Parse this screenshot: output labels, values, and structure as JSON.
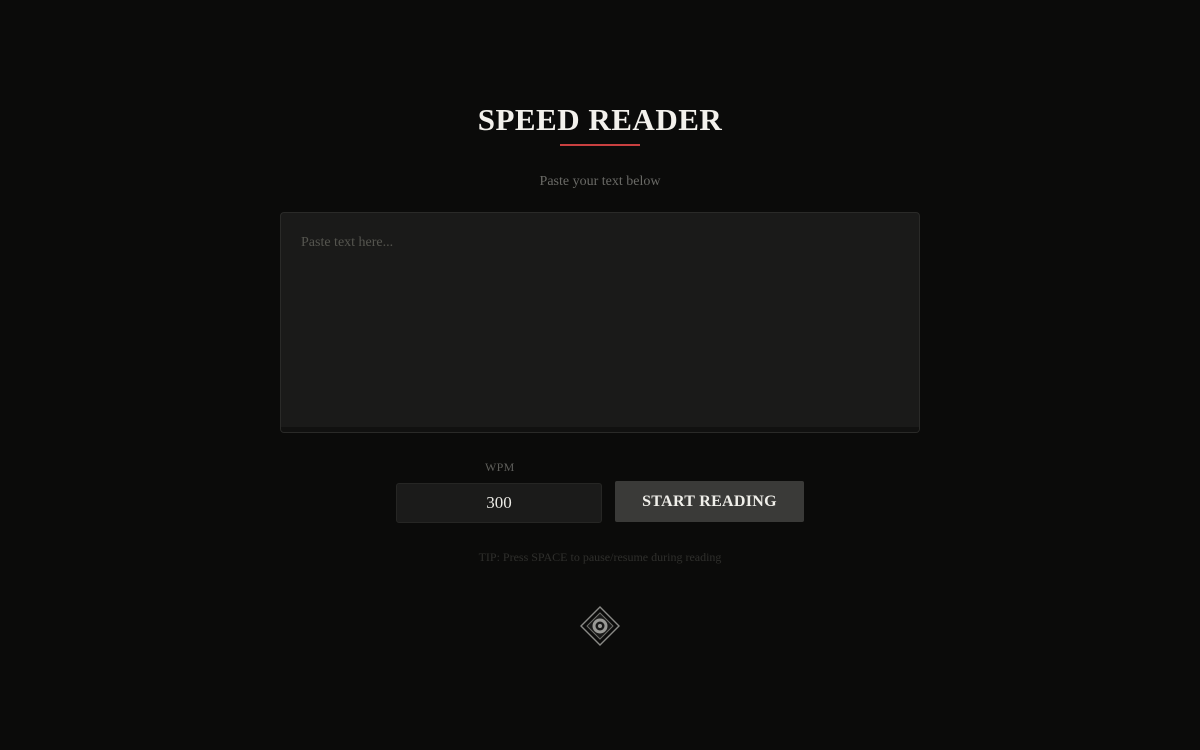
{
  "header": {
    "title": "SPEED READER",
    "accent_color": "#c94040",
    "subtitle": "Paste your text below"
  },
  "text_area": {
    "placeholder": "Paste text here...",
    "value": ""
  },
  "controls": {
    "wpm_label": "WPM",
    "wpm_value": "300",
    "start_label": "START READING"
  },
  "tip": "TIP: Press SPACE to pause/resume during reading",
  "footer": {
    "logo_icon": "diamond-eye-icon"
  }
}
